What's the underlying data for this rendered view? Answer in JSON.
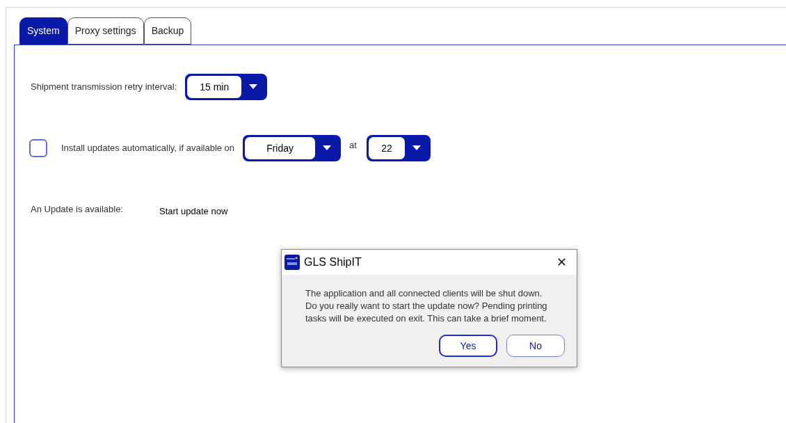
{
  "tabs": [
    {
      "label": "System",
      "selected": true
    },
    {
      "label": "Proxy settings",
      "selected": false
    },
    {
      "label": "Backup",
      "selected": false
    }
  ],
  "retry": {
    "label": "Shipment transmission retry interval:",
    "value": "15 min"
  },
  "auto_update": {
    "checked": false,
    "label": "Install updates automatically, if available on",
    "day": "Friday",
    "at_label": "at",
    "hour": "22"
  },
  "update": {
    "label": "An Update is available:",
    "action": "Start update now"
  },
  "dialog": {
    "title": "GLS ShipIT",
    "close": "✕",
    "message": "The application and all connected clients will be shut down. Do you really want to start the update now? Pending printing tasks will be executed on exit. This can take a brief moment.",
    "buttons": [
      {
        "label": "Yes",
        "focused": true
      },
      {
        "label": "No",
        "focused": false
      }
    ]
  }
}
